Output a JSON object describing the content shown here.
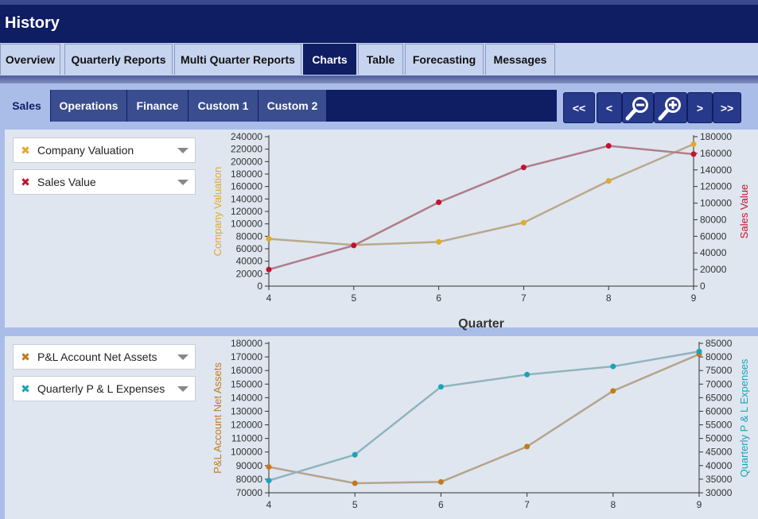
{
  "app_title": "History",
  "nav": {
    "tabs": [
      {
        "label": "Overview"
      },
      {
        "label": "Quarterly Reports"
      },
      {
        "label": "Multi Quarter Reports"
      },
      {
        "label": "Charts",
        "active": true
      },
      {
        "label": "Table"
      },
      {
        "label": "Forecasting"
      },
      {
        "label": "Messages"
      }
    ]
  },
  "subnav": {
    "tabs": [
      {
        "label": "Sales",
        "active": true
      },
      {
        "label": "Operations"
      },
      {
        "label": "Finance"
      },
      {
        "label": "Custom 1"
      },
      {
        "label": "Custom 2"
      }
    ],
    "controls": {
      "first": "<<",
      "prev": "<",
      "zoom_out_icon": "zoom-out-icon",
      "zoom_in_icon": "zoom-in-icon",
      "next": ">",
      "last": ">>"
    }
  },
  "panels": [
    {
      "legend": [
        {
          "label": "Company Valuation",
          "marker_color": "#e3a92a"
        },
        {
          "label": "Sales Value",
          "marker_color": "#c4112e"
        }
      ]
    },
    {
      "legend": [
        {
          "label": "P&L Account Net Assets",
          "marker_color": "#c47a1b"
        },
        {
          "label": "Quarterly P & L Expenses",
          "marker_color": "#1aa3b8"
        }
      ]
    }
  ],
  "chart_data": [
    {
      "type": "line",
      "x": [
        4,
        5,
        6,
        7,
        8,
        9
      ],
      "xlabel": "Quarter",
      "xlim": [
        4,
        9
      ],
      "ylabel_left": "Company Valuation",
      "ylabel_right": "Sales Value",
      "ylim_left": [
        0,
        240000
      ],
      "ylim_right": [
        0,
        180000
      ],
      "yticks_left": [
        "0",
        "20000",
        "40000",
        "60000",
        "80000",
        "100000",
        "120000",
        "140000",
        "160000",
        "180000",
        "200000",
        "220000",
        "240000"
      ],
      "yticks_right": [
        "0",
        "20000",
        "40000",
        "60000",
        "80000",
        "100000",
        "120000",
        "140000",
        "160000",
        "180000"
      ],
      "xticks": [
        "4",
        "5",
        "6",
        "7",
        "8",
        "9"
      ],
      "series": [
        {
          "name": "Company Valuation",
          "axis": "left",
          "color": "#e3a92a",
          "line_color": "#b9a98c",
          "values": [
            76000,
            66000,
            71000,
            102000,
            169000,
            228000
          ]
        },
        {
          "name": "Sales Value",
          "axis": "right",
          "color": "#c4112e",
          "line_color": "#b07d8a",
          "values": [
            20000,
            49000,
            101000,
            143000,
            169000,
            159000
          ]
        }
      ]
    },
    {
      "type": "line",
      "x": [
        4,
        5,
        6,
        7,
        8,
        9
      ],
      "xlim": [
        4,
        9
      ],
      "ylabel_left": "P&L Account Net Assets",
      "ylabel_right": "Quarterly P & L Expenses",
      "ylim_left": [
        70000,
        180000
      ],
      "ylim_right": [
        30000,
        85000
      ],
      "yticks_left": [
        "70000",
        "80000",
        "90000",
        "100000",
        "110000",
        "120000",
        "130000",
        "140000",
        "150000",
        "160000",
        "170000",
        "180000"
      ],
      "yticks_right": [
        "30000",
        "35000",
        "40000",
        "45000",
        "50000",
        "55000",
        "60000",
        "65000",
        "70000",
        "75000",
        "80000",
        "85000"
      ],
      "xticks": [
        "4",
        "5",
        "6",
        "7",
        "8",
        "9"
      ],
      "series": [
        {
          "name": "P&L Account Net Assets",
          "axis": "left",
          "color": "#c47a1b",
          "line_color": "#b5a48d",
          "values": [
            89000,
            77000,
            78000,
            104000,
            145000,
            172000
          ]
        },
        {
          "name": "Quarterly P & L Expenses",
          "axis": "right",
          "color": "#1aa3b8",
          "line_color": "#8fb4c0",
          "values": [
            34500,
            44000,
            69000,
            73500,
            76500,
            82000
          ]
        }
      ]
    }
  ]
}
